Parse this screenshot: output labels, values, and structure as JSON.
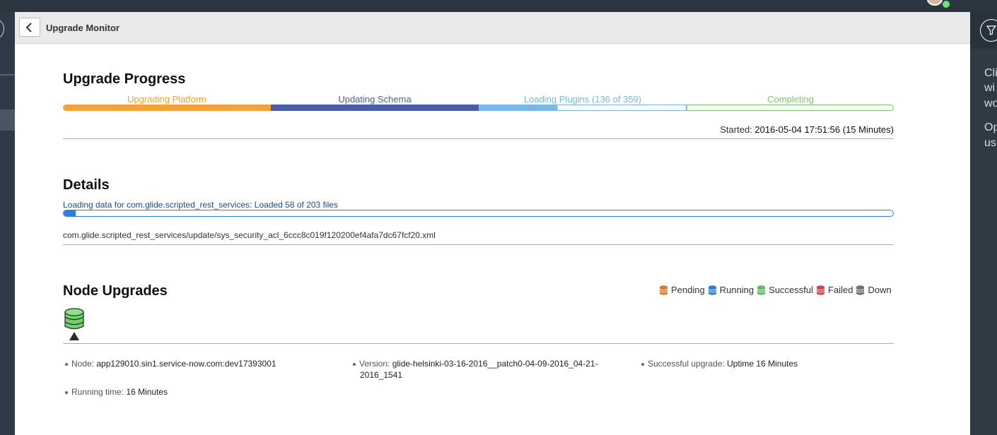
{
  "header": {
    "title": "Upgrade Monitor"
  },
  "progress": {
    "title": "Upgrade Progress",
    "stages": [
      {
        "label": "Upgrading Platform",
        "color": "#f4a23a",
        "fraction": 1.0
      },
      {
        "label": "Updating Schema",
        "color": "#4a5ea8",
        "fraction": 1.0
      },
      {
        "label": "Loading Plugins (136 of 359)",
        "color": "#7ab6e6",
        "fraction": 0.379
      },
      {
        "label": "Completing",
        "color": "#7bcc6a",
        "fraction": 0.0
      }
    ],
    "started_label": "Started:",
    "started_value": "2016-05-04 17:51:56 (15 Minutes)"
  },
  "details": {
    "title": "Details",
    "status_text": "Loading data for com.glide.scripted_rest_services: Loaded 58 of 203 files",
    "progress_fraction": 0.0143,
    "file": "com.glide.scripted_rest_services/update/sys_security_acl_6ccc8c019f120200ef4afa7dc67fcf20.xml",
    "bar_color": "#2f7fdc"
  },
  "nodes": {
    "title": "Node Upgrades",
    "legend": [
      {
        "label": "Pending",
        "color": "#e07b2c"
      },
      {
        "label": "Running",
        "color": "#2f7fdc"
      },
      {
        "label": "Successful",
        "color": "#58c060"
      },
      {
        "label": "Failed",
        "color": "#d9434a"
      },
      {
        "label": "Down",
        "color": "#6b7178"
      }
    ],
    "node_icon": "database-icon",
    "info": {
      "node_label": "Node:",
      "node_value": "app129010.sin1.service-now.com:dev17393001",
      "version_label": "Version:",
      "version_value_line1": "glide-helsinki-03-16-2016__patch0-04-09-2016_04-21-",
      "version_value_line2": "2016_1541",
      "success_label": "Successful upgrade:",
      "success_value": "Uptime 16 Minutes",
      "running_label": "Running time:",
      "running_value": "16 Minutes"
    }
  },
  "right_panel": {
    "icon": "filter-icon",
    "lines": [
      "Cli",
      "wi",
      "wo",
      "Op",
      "us"
    ]
  }
}
